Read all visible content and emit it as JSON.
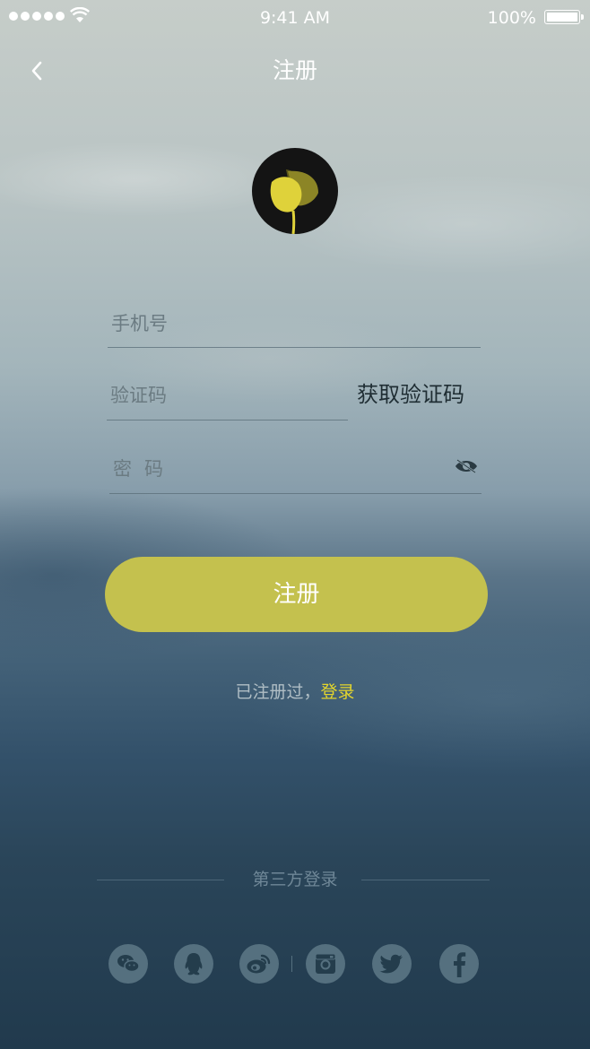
{
  "status_bar": {
    "time": "9:41 AM",
    "battery_percent": "100%",
    "battery_level": 1.0,
    "signal_bars": 5
  },
  "nav": {
    "title": "注册",
    "back_icon": "chevron-left-icon"
  },
  "logo": {
    "icon": "tulip-leaf-logo",
    "bg_color": "#141414",
    "accent_color": "#dfd23a"
  },
  "form": {
    "phone_placeholder": "手机号",
    "phone_value": "",
    "code_placeholder": "验证码",
    "code_value": "",
    "get_code_label": "获取验证码",
    "password_placeholder": "密码",
    "password_value": "",
    "password_toggle_icon": "eye-hidden-icon"
  },
  "register_button": {
    "label": "注册",
    "color": "#c4c14e"
  },
  "login_hint": {
    "text": "已注册过，",
    "link_label": "登录",
    "link_color": "#e3d52d"
  },
  "third_party": {
    "title": "第三方登录",
    "icons": [
      "wechat-icon",
      "qq-icon",
      "weibo-icon",
      "instagram-icon",
      "twitter-icon",
      "facebook-icon"
    ]
  }
}
